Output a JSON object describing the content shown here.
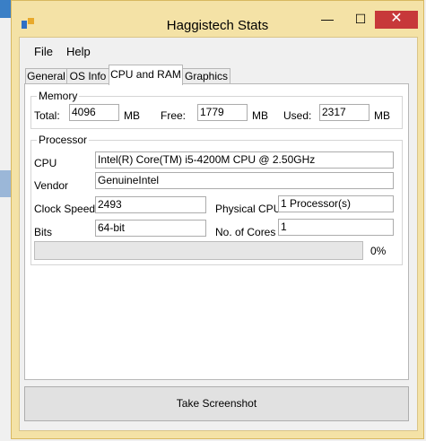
{
  "window": {
    "title": "Haggistech Stats",
    "minimize_glyph": "—",
    "maximize_glyph": "☐",
    "close_glyph": "✕"
  },
  "menu": {
    "items": [
      "File",
      "Help"
    ]
  },
  "tabs": {
    "items": [
      "General",
      "OS Info",
      "CPU and RAM",
      "Graphics"
    ],
    "active": "CPU and RAM"
  },
  "memory": {
    "group_label": "Memory",
    "total_label": "Total:",
    "total_value": "4096",
    "total_unit": "MB",
    "free_label": "Free:",
    "free_value": "1779",
    "free_unit": "MB",
    "used_label": "Used:",
    "used_value": "2317",
    "used_unit": "MB"
  },
  "processor": {
    "group_label": "Processor",
    "cpu_label": "CPU",
    "cpu_value": "Intel(R) Core(TM) i5-4200M CPU @ 2.50GHz",
    "vendor_label": "Vendor",
    "vendor_value": "GenuineIntel",
    "clock_label": "Clock Speed",
    "clock_value": "2493",
    "physical_label": "Physical CPU:",
    "physical_value": "1 Processor(s)",
    "bits_label": "Bits",
    "bits_value": "64-bit",
    "cores_label": "No. of Cores",
    "cores_value": "1",
    "progress_fraction": 0.0,
    "progress_text": "0%"
  },
  "actions": {
    "screenshot_label": "Take Screenshot"
  },
  "colors": {
    "close_button": "#c7383a",
    "window_frame": "#f4e2a6",
    "desktop_strip": "#3a7fc6",
    "progress_fill": "#06b025"
  }
}
